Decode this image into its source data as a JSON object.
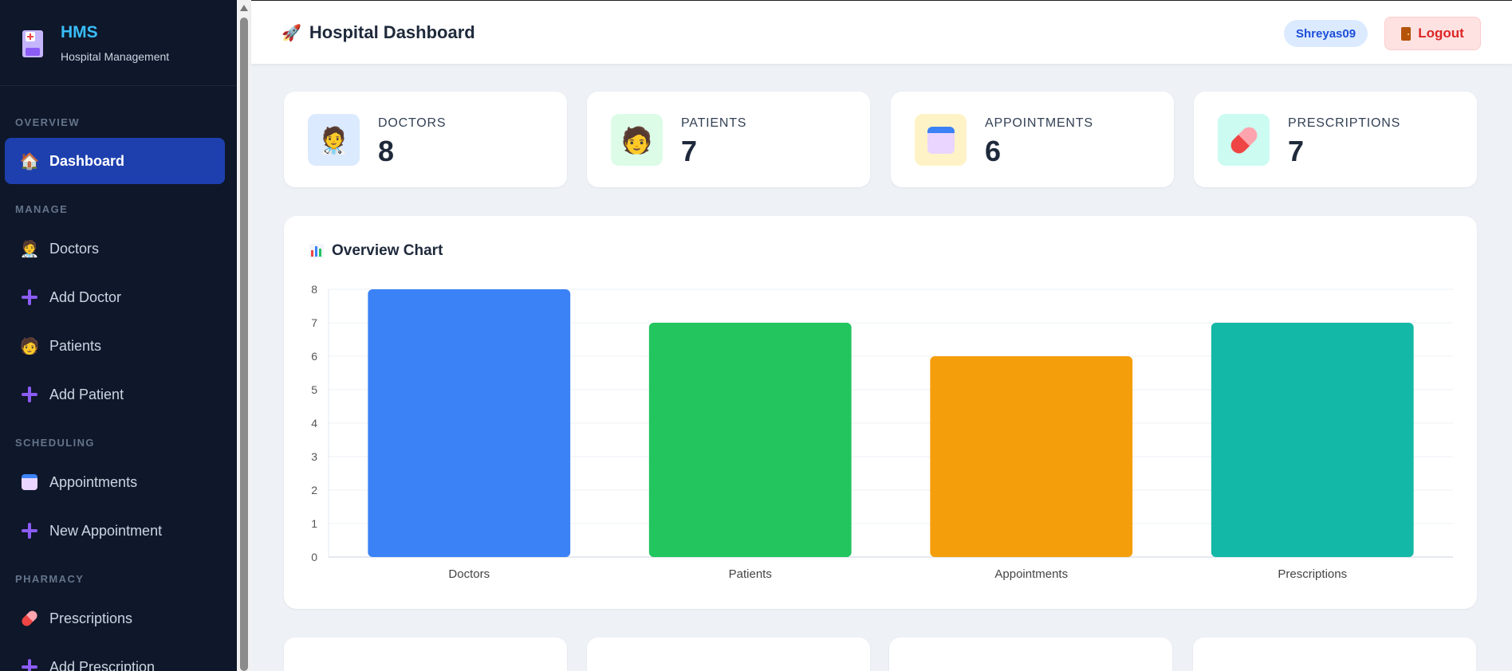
{
  "brand": {
    "title": "HMS",
    "subtitle": "Hospital Management"
  },
  "sidebar": {
    "sections": [
      {
        "label": "OVERVIEW"
      },
      {
        "label": "MANAGE"
      },
      {
        "label": "SCHEDULING"
      },
      {
        "label": "PHARMACY"
      }
    ],
    "items": [
      {
        "label": "Dashboard",
        "icon": "house-icon",
        "active": true
      },
      {
        "label": "Doctors",
        "icon": "doctor-icon"
      },
      {
        "label": "Add Doctor",
        "icon": "plus-icon"
      },
      {
        "label": "Patients",
        "icon": "patient-icon"
      },
      {
        "label": "Add Patient",
        "icon": "plus-icon"
      },
      {
        "label": "Appointments",
        "icon": "calendar-icon"
      },
      {
        "label": "New Appointment",
        "icon": "plus-icon"
      },
      {
        "label": "Prescriptions",
        "icon": "pill-icon"
      },
      {
        "label": "Add Prescription",
        "icon": "plus-icon"
      }
    ]
  },
  "header": {
    "title": "Hospital Dashboard",
    "user": "Shreyas09",
    "logout_label": "Logout"
  },
  "stats": [
    {
      "label": "DOCTORS",
      "value": "8",
      "icon": "doctor-icon",
      "bg": "#dbeafe"
    },
    {
      "label": "PATIENTS",
      "value": "7",
      "icon": "patient-icon",
      "bg": "#dcfce7"
    },
    {
      "label": "APPOINTMENTS",
      "value": "6",
      "icon": "calendar-icon",
      "bg": "#fef3c7"
    },
    {
      "label": "PRESCRIPTIONS",
      "value": "7",
      "icon": "pill-icon",
      "bg": "#ccfbf1"
    }
  ],
  "chart": {
    "title": "Overview Chart"
  },
  "chart_data": {
    "type": "bar",
    "title": "Overview Chart",
    "categories": [
      "Doctors",
      "Patients",
      "Appointments",
      "Prescriptions"
    ],
    "values": [
      8,
      7,
      6,
      7
    ],
    "colors": [
      "#3b82f6",
      "#22c55e",
      "#f59e0b",
      "#14b8a6"
    ],
    "ylim": [
      0,
      8
    ],
    "yticks": [
      "0",
      "1",
      "2",
      "3",
      "4",
      "5",
      "6",
      "7",
      "8"
    ],
    "grid": true,
    "xlabel": "",
    "ylabel": ""
  }
}
